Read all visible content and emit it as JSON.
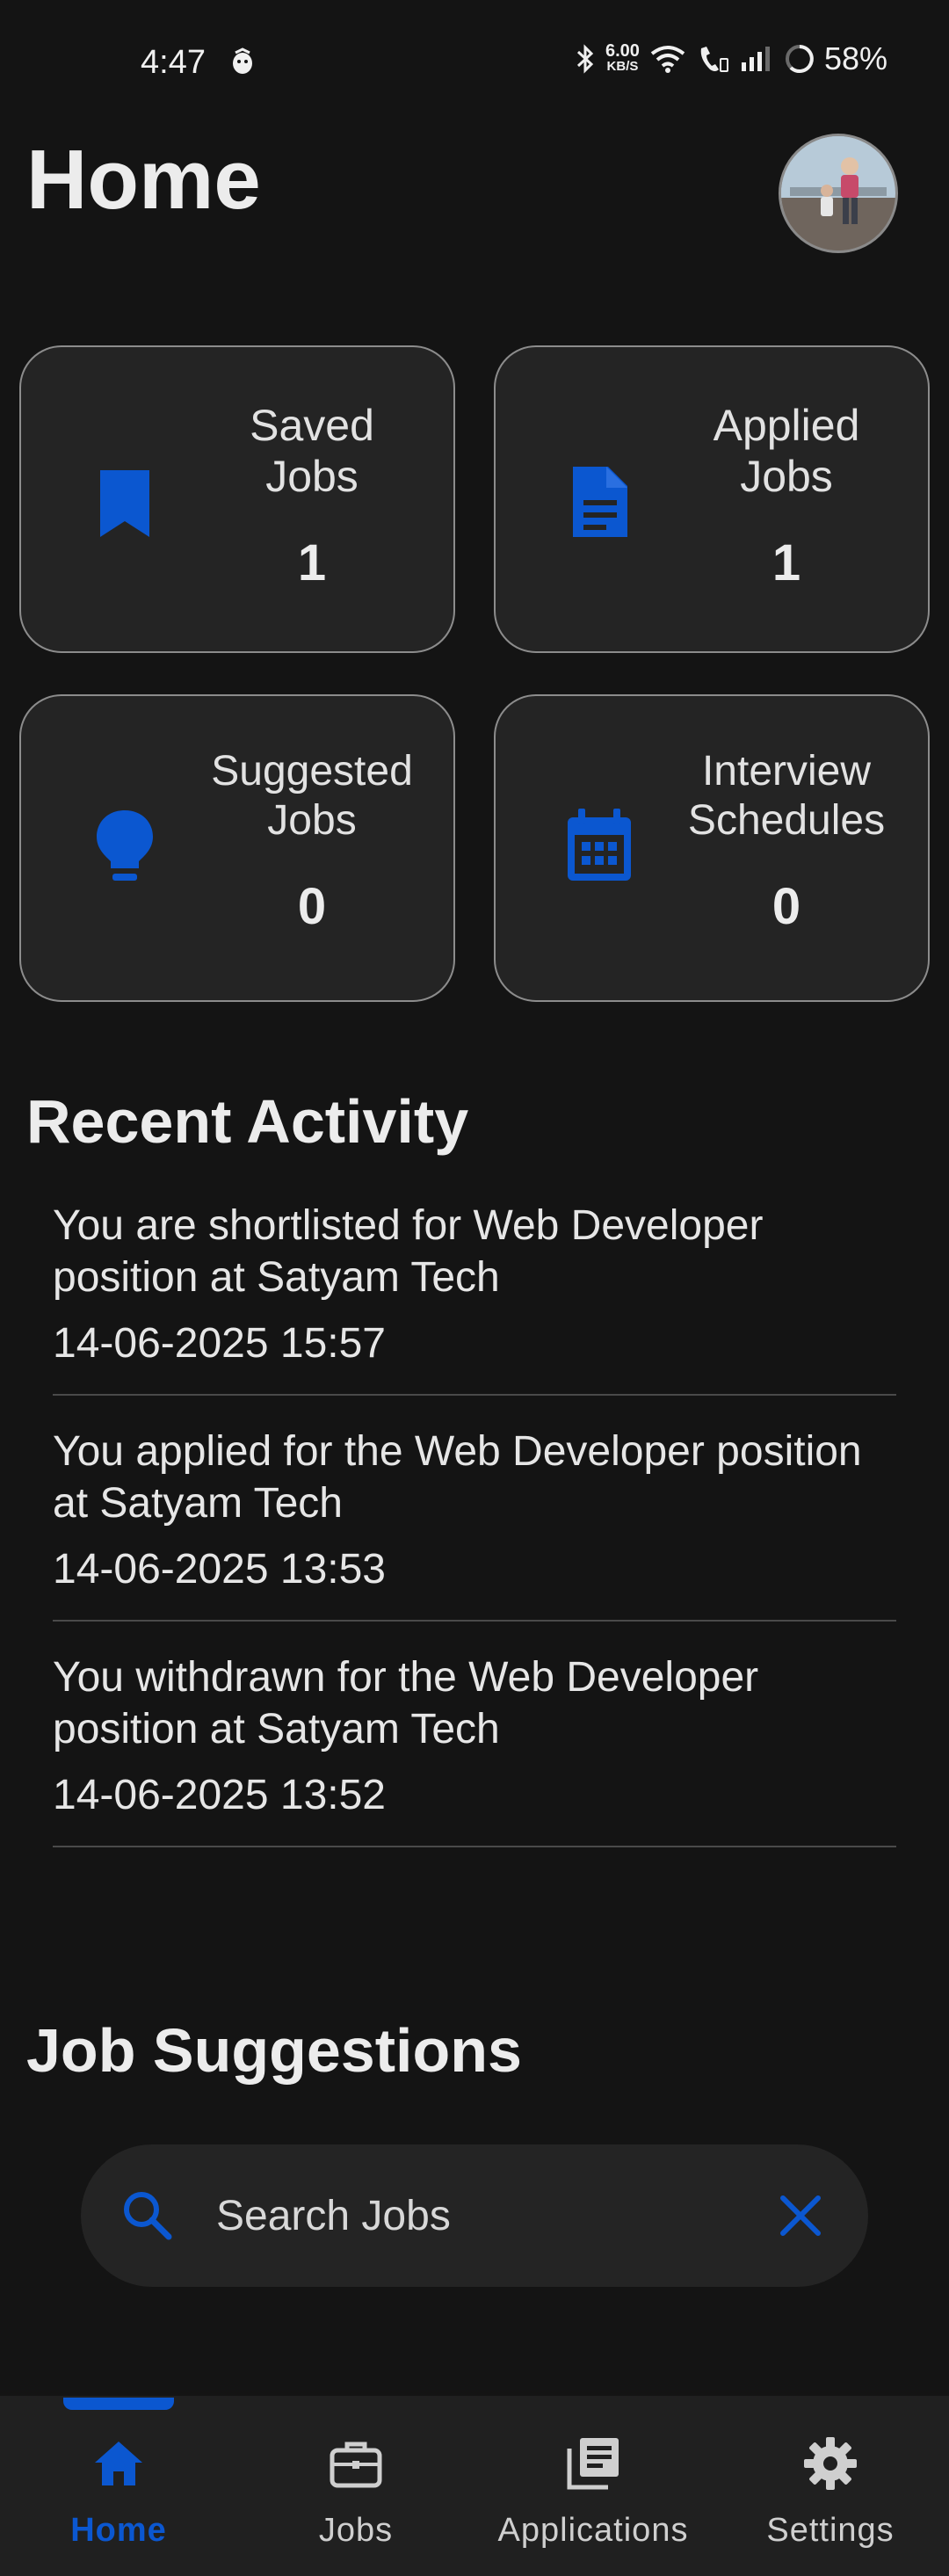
{
  "status_bar": {
    "time": "4:47",
    "net_speed_value": "6.00",
    "net_speed_unit": "KB/S",
    "battery": "58%"
  },
  "header": {
    "title": "Home"
  },
  "stats": [
    {
      "label": "Saved\nJobs",
      "count": "1",
      "icon": "bookmark-icon"
    },
    {
      "label": "Applied\nJobs",
      "count": "1",
      "icon": "document-icon"
    },
    {
      "label": "Suggested\nJobs",
      "count": "0",
      "icon": "lightbulb-icon"
    },
    {
      "label": "Interview\nSchedules",
      "count": "0",
      "icon": "calendar-icon"
    }
  ],
  "recent_activity": {
    "title": "Recent Activity",
    "items": [
      {
        "text": "You are shortlisted for Web Developer position at Satyam Tech",
        "time": "14-06-2025 15:57"
      },
      {
        "text": "You applied for the Web Developer position at Satyam Tech",
        "time": "14-06-2025 13:53"
      },
      {
        "text": "You withdrawn for the Web Developer position at Satyam Tech",
        "time": "14-06-2025 13:52"
      }
    ]
  },
  "job_suggestions": {
    "title": "Job Suggestions",
    "search_placeholder": "Search Jobs"
  },
  "bottom_nav": {
    "items": [
      {
        "label": "Home",
        "icon": "home-icon",
        "active": true
      },
      {
        "label": "Jobs",
        "icon": "briefcase-icon",
        "active": false
      },
      {
        "label": "Applications",
        "icon": "library-icon",
        "active": false
      },
      {
        "label": "Settings",
        "icon": "gear-icon",
        "active": false
      }
    ]
  },
  "colors": {
    "background": "#141414",
    "card": "#242424",
    "accent": "#0b57d0",
    "text": "#e8e8e8"
  }
}
